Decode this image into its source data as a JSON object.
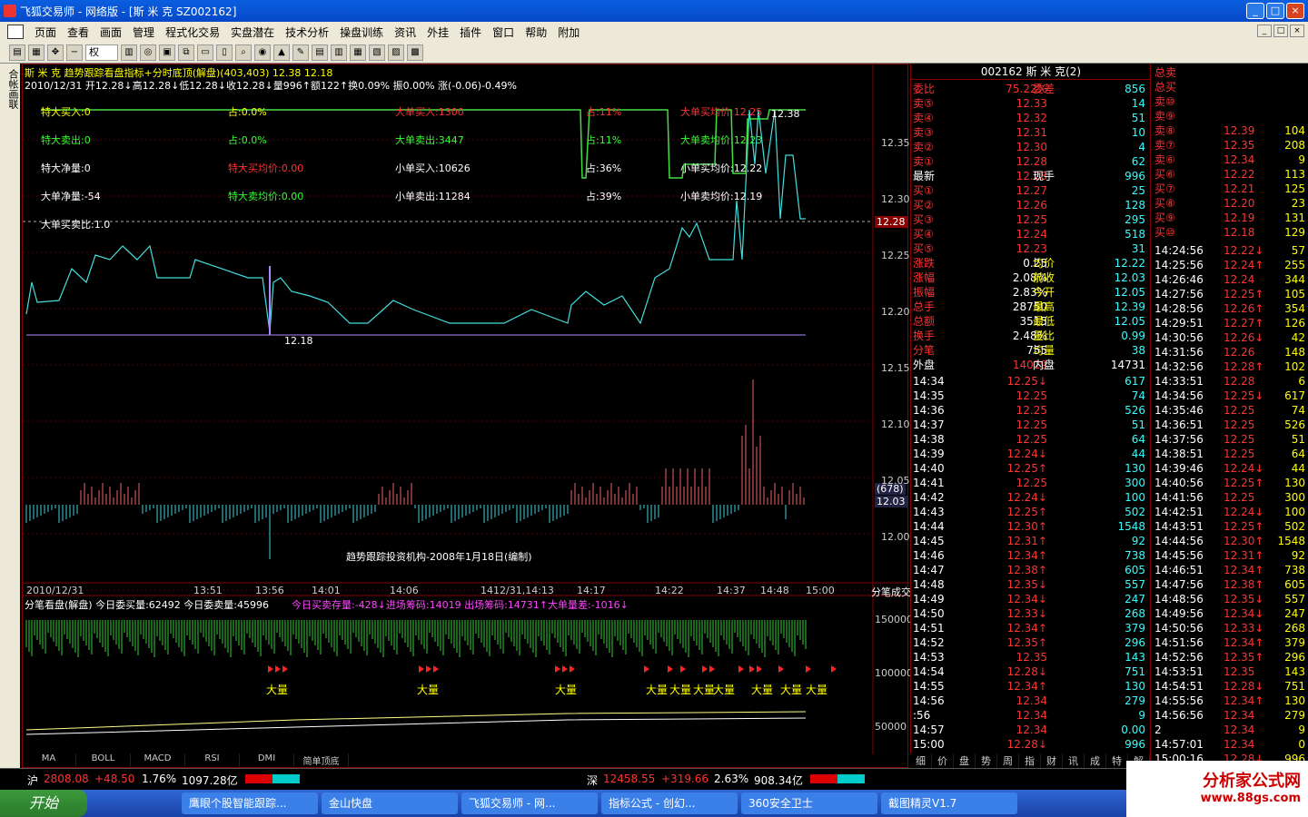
{
  "window": {
    "title": "飞狐交易师 - 网络版 - [斯 米 克 SZ002162]"
  },
  "menu": [
    "页面",
    "查看",
    "画面",
    "管理",
    "程式化交易",
    "实盘潜在",
    "技术分析",
    "操盘训练",
    "资讯",
    "外挂",
    "插件",
    "窗口",
    "帮助",
    "附加"
  ],
  "toolbar": {
    "select_value": "权"
  },
  "leftbar": {
    "label": "合帐画联"
  },
  "chart": {
    "header1": "斯 米 克  趋势跟踪看盘指标+分时底顶(解盘)(403,403)  12.38  12.18",
    "header2": "2010/12/31  开12.28↓高12.28↓低12.28↓收12.28↓量996↑额122↑换0.09%  振0.00%  涨(-0.06)-0.49%",
    "stats": [
      {
        "label": "特大买入:0",
        "color": "#ff0"
      },
      {
        "label": "占:0.0%",
        "color": "#ff0"
      },
      {
        "label": "大单买入:1300",
        "color": "#f33"
      },
      {
        "label": "占:11%",
        "color": "#f33"
      },
      {
        "label": "大单买均价:12.25",
        "color": "#f33"
      },
      {
        "label": "特大卖出:0",
        "color": "#3f3"
      },
      {
        "label": "占:0.0%",
        "color": "#3f3"
      },
      {
        "label": "大单卖出:3447",
        "color": "#3f3"
      },
      {
        "label": "占:11%",
        "color": "#3f3"
      },
      {
        "label": "大单卖均价:12.23",
        "color": "#3f3"
      },
      {
        "label": "特大净量:0",
        "color": "#fff"
      },
      {
        "label": "特大买均价:0.00",
        "color": "#f33"
      },
      {
        "label": "小单买入:10626",
        "color": "#fff"
      },
      {
        "label": "占:36%",
        "color": "#fff"
      },
      {
        "label": "小单买均价:12.22",
        "color": "#fff"
      },
      {
        "label": "大单净量:-54",
        "color": "#fff"
      },
      {
        "label": "特大卖均价:0.00",
        "color": "#3f3"
      },
      {
        "label": "小单卖出:11284",
        "color": "#fff"
      },
      {
        "label": "占:39%",
        "color": "#fff"
      },
      {
        "label": "小单卖均价:12.19",
        "color": "#fff"
      },
      {
        "label": "大单买卖比:1.0",
        "color": "#fff"
      }
    ],
    "price_axis": [
      "12.35",
      "12.30",
      "12.25",
      "12.20",
      "12.15",
      "12.10",
      "12.05",
      "12.00"
    ],
    "price_tag": "12.28",
    "vol_tag": [
      "(678)",
      "12.03"
    ],
    "high_label": "12.38",
    "low_label": "12.18",
    "credit": "趋势跟踪投资机构-2008年1月18日(编制)",
    "time_axis": [
      "2010/12/31",
      "13:51",
      "13:56",
      "14:01",
      "14:06",
      "1412/31,14:13",
      "14:17",
      "14:22",
      "14:37",
      "14:48",
      "15:00"
    ],
    "indicator_header": "分笔看盘(解盘)  今日委买量:62492  今日委卖量:45996",
    "indicator_extra": "今日买卖存量:-428↓进场筹码:14019  出场筹码:14731↑大单量差:-1016↓",
    "ind_axis": [
      "150000",
      "100000",
      "50000"
    ],
    "right_label": "分笔成交",
    "big_labels": [
      "大量",
      "大量",
      "大量",
      "大量",
      "大量",
      "大量",
      "大量",
      "大量",
      "大量",
      "大量"
    ],
    "bottom_tabs": [
      "MA",
      "BOLL",
      "MACD",
      "RSI",
      "DMI",
      "简单顶底"
    ]
  },
  "panel": {
    "title": "002162 斯 米 克(2)",
    "webi": {
      "label": "委比",
      "value": "75.22%",
      "label2": "委差",
      "value2": "856"
    },
    "asks": [
      [
        "卖⑤",
        "12.33",
        "14"
      ],
      [
        "卖④",
        "12.32",
        "51"
      ],
      [
        "卖③",
        "12.31",
        "10"
      ],
      [
        "卖②",
        "12.30",
        "4"
      ],
      [
        "卖①",
        "12.28",
        "62"
      ]
    ],
    "latest": [
      "最新",
      "12.28",
      "现手",
      "996"
    ],
    "bids": [
      [
        "买①",
        "12.27",
        "25"
      ],
      [
        "买②",
        "12.26",
        "128"
      ],
      [
        "买③",
        "12.25",
        "295"
      ],
      [
        "买④",
        "12.24",
        "518"
      ],
      [
        "买⑤",
        "12.23",
        "31"
      ]
    ],
    "stats": [
      [
        "涨跌",
        "0.25",
        "均价",
        "12.22"
      ],
      [
        "涨幅",
        "2.08%",
        "前收",
        "12.03"
      ],
      [
        "振幅",
        "2.83%",
        "今开",
        "12.05"
      ],
      [
        "总手",
        "28750",
        "最高",
        "12.39"
      ],
      [
        "总额",
        "3515",
        "最低",
        "12.05"
      ],
      [
        "换手",
        "2.48%",
        "量比",
        "0.99"
      ],
      [
        "分笔",
        "755",
        "均量",
        "38"
      ]
    ],
    "outer": [
      "外盘",
      "14019",
      "内盘",
      "14731"
    ],
    "ticks": [
      [
        "14:34",
        "12.25↓",
        "617"
      ],
      [
        "14:35",
        "12.25",
        "74"
      ],
      [
        "14:36",
        "12.25",
        "526"
      ],
      [
        "14:37",
        "12.25",
        "51"
      ],
      [
        "14:38",
        "12.25",
        "64"
      ],
      [
        "14:39",
        "12.24↓",
        "44"
      ],
      [
        "14:40",
        "12.25↑",
        "130"
      ],
      [
        "14:41",
        "12.25",
        "300"
      ],
      [
        "14:42",
        "12.24↓",
        "100"
      ],
      [
        "14:43",
        "12.25↑",
        "502"
      ],
      [
        "14:44",
        "12.30↑",
        "1548"
      ],
      [
        "14:45",
        "12.31↑",
        "92"
      ],
      [
        "14:46",
        "12.34↑",
        "738"
      ],
      [
        "14:47",
        "12.38↑",
        "605"
      ],
      [
        "14:48",
        "12.35↓",
        "557"
      ],
      [
        "14:49",
        "12.34↓",
        "247"
      ],
      [
        "14:50",
        "12.33↓",
        "268"
      ],
      [
        "14:51",
        "12.34↑",
        "379"
      ],
      [
        "14:52",
        "12.35↑",
        "296"
      ],
      [
        "14:53",
        "12.35",
        "143"
      ],
      [
        "14:54",
        "12.28↓",
        "751"
      ],
      [
        "14:55",
        "12.34↑",
        "130"
      ],
      [
        "14:56",
        "12.34",
        "279"
      ],
      [
        ":56",
        "12.34",
        "9"
      ],
      [
        "14:57",
        "12.34",
        "0.00"
      ],
      [
        "15:00",
        "12.28↓",
        "996"
      ]
    ],
    "tabs": [
      "细",
      "价",
      "盘",
      "势",
      "周",
      "指",
      "财",
      "讯",
      "成",
      "特",
      "解"
    ]
  },
  "rpanel": {
    "top": [
      [
        "总卖",
        "",
        ""
      ],
      [
        "总买",
        "",
        ""
      ],
      [
        "卖⑩",
        "",
        ""
      ],
      [
        "卖⑨",
        "",
        ""
      ],
      [
        "卖⑧",
        "12.39",
        "104"
      ],
      [
        "卖⑦",
        "12.35",
        "208"
      ],
      [
        "卖⑥",
        "12.34",
        "9"
      ],
      [
        "买⑥",
        "12.22",
        "113"
      ],
      [
        "买⑦",
        "12.21",
        "125"
      ],
      [
        "买⑧",
        "12.20",
        "23"
      ],
      [
        "买⑨",
        "12.19",
        "131"
      ],
      [
        "买⑩",
        "12.18",
        "129"
      ]
    ],
    "ticks": [
      [
        "14:24:56",
        "12.22↓",
        "57"
      ],
      [
        "14:25:56",
        "12.24↑",
        "255"
      ],
      [
        "14:26:46",
        "12.24",
        "344"
      ],
      [
        "14:27:56",
        "12.25↑",
        "105"
      ],
      [
        "14:28:56",
        "12.26↑",
        "354"
      ],
      [
        "14:29:51",
        "12.27↑",
        "126"
      ],
      [
        "14:30:56",
        "12.26↓",
        "42"
      ],
      [
        "14:31:56",
        "12.26",
        "148"
      ],
      [
        "14:32:56",
        "12.28↑",
        "102"
      ],
      [
        "14:33:51",
        "12.28",
        "6"
      ],
      [
        "14:34:56",
        "12.25↓",
        "617"
      ],
      [
        "14:35:46",
        "12.25",
        "74"
      ],
      [
        "14:36:51",
        "12.25",
        "526"
      ],
      [
        "14:37:56",
        "12.25",
        "51"
      ],
      [
        "14:38:51",
        "12.25",
        "64"
      ],
      [
        "14:39:46",
        "12.24↓",
        "44"
      ],
      [
        "14:40:56",
        "12.25↑",
        "130"
      ],
      [
        "14:41:56",
        "12.25",
        "300"
      ],
      [
        "14:42:51",
        "12.24↓",
        "100"
      ],
      [
        "14:43:51",
        "12.25↑",
        "502"
      ],
      [
        "14:44:56",
        "12.30↑",
        "1548"
      ],
      [
        "14:45:56",
        "12.31↑",
        "92"
      ],
      [
        "14:46:51",
        "12.34↑",
        "738"
      ],
      [
        "14:47:56",
        "12.38↑",
        "605"
      ],
      [
        "14:48:56",
        "12.35↓",
        "557"
      ],
      [
        "14:49:56",
        "12.34↓",
        "247"
      ],
      [
        "14:50:56",
        "12.33↓",
        "268"
      ],
      [
        "14:51:56",
        "12.34↑",
        "379"
      ],
      [
        "14:52:56",
        "12.35↑",
        "296"
      ],
      [
        "14:53:51",
        "12.35",
        "143"
      ],
      [
        "14:54:51",
        "12.28↓",
        "751"
      ],
      [
        "14:55:56",
        "12.34↑",
        "130"
      ],
      [
        "14:56:56",
        "12.34",
        "279"
      ],
      [
        "2",
        "12.34",
        "9"
      ],
      [
        "14:57:01",
        "12.34",
        "0"
      ],
      [
        "15:00:16",
        "12.28↓",
        "996"
      ]
    ]
  },
  "status": {
    "sh_label": "沪",
    "sh": "2808.08",
    "sh_chg": "+48.50",
    "sh_pct": "1.76%",
    "sh_amt": "1097.28亿",
    "sz_label": "深",
    "sz": "12458.55",
    "sz_chg": "+319.66",
    "sz_pct": "2.63%",
    "sz_amt": "908.34亿"
  },
  "taskbar": {
    "start": "开始",
    "tasks": [
      "鹰眼个股智能跟踪...",
      "金山快盘",
      "飞狐交易师 - 网...",
      "指标公式 - 创幻...",
      "360安全卫士",
      "截图精灵V1.7"
    ]
  },
  "brand": {
    "name": "分析家公式网",
    "url": "www.88gs.com"
  }
}
